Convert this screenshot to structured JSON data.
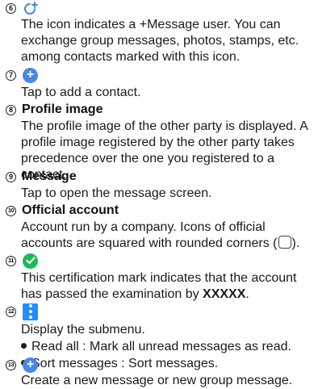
{
  "items": [
    {
      "number": "6",
      "body": "The icon indicates a +Message user. You can exchange group messages, photos, stamps, etc. among contacts marked with this icon."
    },
    {
      "number": "7",
      "body": "Tap to add a contact."
    },
    {
      "number": "8",
      "title": "Profile image",
      "body": "The profile image of the other party is displayed. A profile image registered by the other party takes precedence over the one you registered to a contact."
    },
    {
      "number": "9",
      "title": "Message",
      "body": "Tap to open the message screen."
    },
    {
      "number": "10",
      "title": "Official account",
      "body_part1": "Account run by a company. Icons of official accounts are squared with rounded corners (",
      "body_part2": ")."
    },
    {
      "number": "11",
      "body_part1": "This certification mark indicates that the account has passed the examination by ",
      "body_bold": "XXXXX",
      "body_part2": "."
    },
    {
      "number": "12",
      "body": "Display the submenu.",
      "bullets": [
        "Read all : Mark all unread messages as read.",
        "Sort messages : Sort messages."
      ]
    },
    {
      "number": "13",
      "body": "Create a new message or new group message."
    }
  ],
  "colors": {
    "accent_blue": "#4a86e8",
    "cert_green": "#1db955",
    "submenu_blue": "#1e90ff"
  },
  "icons": {
    "item6": "plus-message-icon",
    "item7": "add-contact-icon",
    "item11": "certification-check-icon",
    "item12": "submenu-kebab-icon",
    "item13": "new-message-icon"
  }
}
